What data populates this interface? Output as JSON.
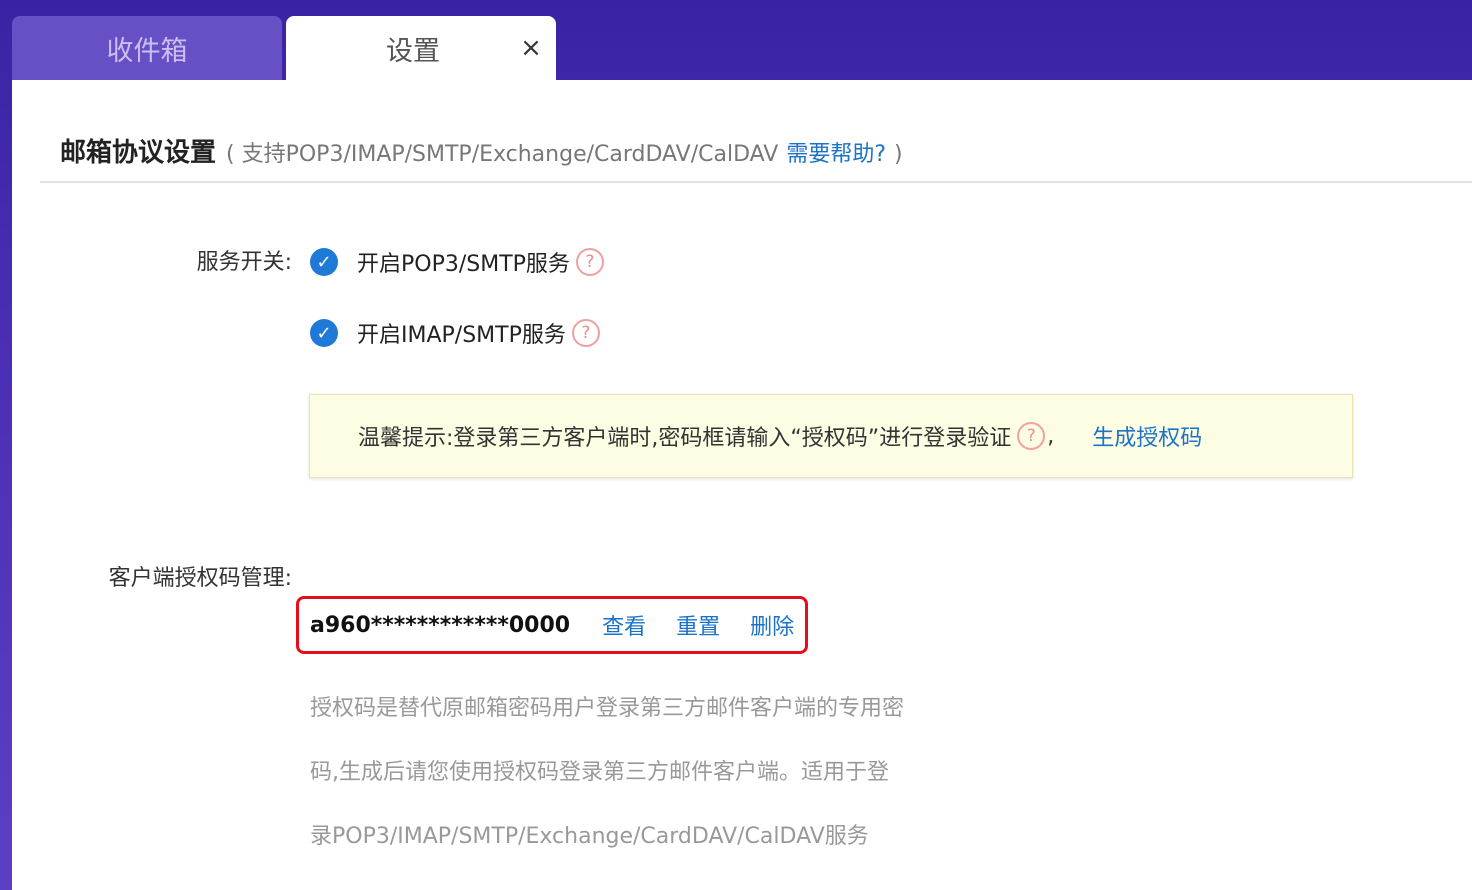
{
  "tabs": [
    {
      "label": "收件箱",
      "active": false
    },
    {
      "label": "设置",
      "active": true,
      "close_icon": "×"
    }
  ],
  "section": {
    "title": "邮箱协议设置",
    "subtitle": "( 支持POP3/IMAP/SMTP/Exchange/CardDAV/CalDAV",
    "help_link": "需要帮助?",
    "subtitle_end": ")"
  },
  "service": {
    "label": "服务开关:",
    "options": [
      {
        "label": "开启POP3/SMTP服务",
        "checked": true
      },
      {
        "label": "开启IMAP/SMTP服务",
        "checked": true
      }
    ]
  },
  "tip": {
    "text": "温馨提示:登录第三方客户端时,密码框请输入“授权码”进行登录验证",
    "comma": ",",
    "link": "生成授权码"
  },
  "auth_code": {
    "label": "客户端授权码管理:",
    "value": "a960************0000",
    "actions": [
      "查看",
      "重置",
      "删除"
    ]
  },
  "description": {
    "lines": [
      "授权码是替代原邮箱密码用户登录第三方邮件客户端的专用密",
      "码,生成后请您使用授权码登录第三方邮件客户端。适用于登",
      "录POP3/IMAP/SMTP/Exchange/CardDAV/CalDAV服务"
    ]
  },
  "icons": {
    "check": "checkmark-icon",
    "help": "question-circle-icon",
    "close": "close-icon"
  },
  "colors": {
    "accent": "#1a73c9",
    "checkbox": "#1e7ad6",
    "highlight_border": "#e3101b",
    "tip_background": "#fdfde3",
    "header_background": "#3a23a3"
  }
}
